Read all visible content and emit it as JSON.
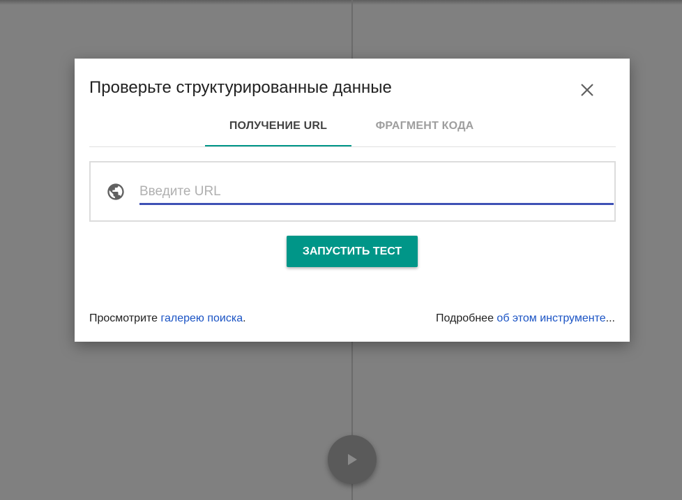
{
  "dialog": {
    "title": "Проверьте структурированные данные",
    "tabs": [
      {
        "label": "ПОЛУЧЕНИЕ URL",
        "active": true
      },
      {
        "label": "ФРАГМЕНТ КОДА",
        "active": false
      }
    ],
    "url_input": {
      "placeholder": "Введите URL",
      "value": ""
    },
    "run_button_label": "ЗАПУСТИТЬ ТЕСТ",
    "footer": {
      "left_prefix": "Просмотрите ",
      "left_link": "галерею поиска",
      "left_suffix": ".",
      "right_prefix": "Подробнее ",
      "right_link": "об этом инструменте",
      "right_suffix": "..."
    }
  },
  "icons": {
    "close": "close-icon",
    "globe": "globe-icon",
    "play": "play-icon"
  },
  "colors": {
    "accent": "#009688",
    "input_underline": "#3f51b5",
    "link": "#1a53c4",
    "overlay": "#808080"
  }
}
